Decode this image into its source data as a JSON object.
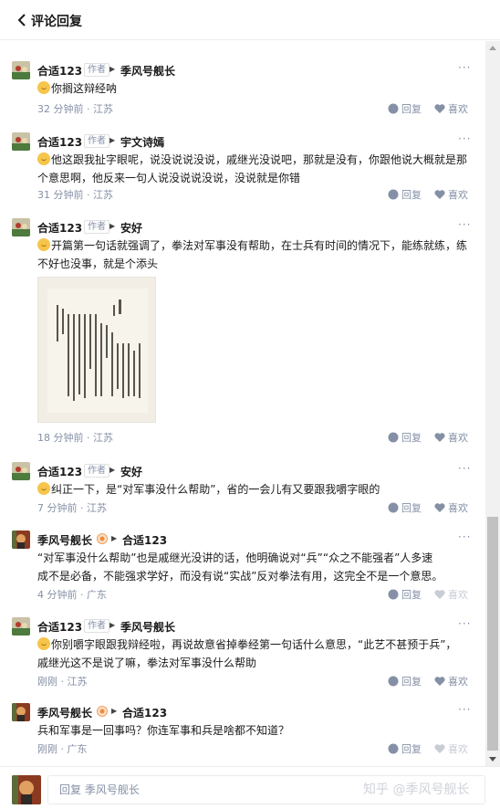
{
  "header": {
    "title": "评论回复"
  },
  "labels": {
    "author_tag": "作者",
    "reply": "回复",
    "like": "喜欢"
  },
  "comments": [
    {
      "author": "合适123",
      "is_author": true,
      "reply_to": "季风号舰长",
      "text": "你搁这辩经呐",
      "emoji": true,
      "time": "32 分钟前",
      "location": "江苏",
      "liked": false
    },
    {
      "author": "合适123",
      "is_author": true,
      "reply_to": "宇文诗嫣",
      "text_lines": [
        "他这跟我扯字眼呢，说没说说没说，戚继光没说吧，那就是没有，你跟他说大概就是那",
        "个意思啊，他反来一句人说没说说没说，没说就是你错"
      ],
      "emoji": true,
      "time": "31 分钟前",
      "location": "江苏",
      "liked": false
    },
    {
      "author": "合适123",
      "is_author": true,
      "reply_to": "安好",
      "text_lines": [
        "开篇第一句话就强调了，拳法对军事没有帮助，在士兵有时间的情况下，能练就练，练",
        "不好也没事，就是个添头"
      ],
      "emoji": true,
      "has_image": true,
      "time": "18 分钟前",
      "location": "江苏",
      "liked": false
    },
    {
      "author": "合适123",
      "is_author": true,
      "reply_to": "安好",
      "text": "纠正一下，是“对军事没什么帮助”，省的一会儿有又要跟我嚼字眼的",
      "emoji": true,
      "time": "7 分钟前",
      "location": "江苏",
      "liked": false
    },
    {
      "author": "季风号舰长",
      "is_author": false,
      "reply_to": "合适123",
      "text_lines": [
        "“对军事没什么帮助”也是戚继光没讲的话，他明确说对“兵”“众之不能强者”人多速",
        "成不是必备，不能强求学好，而没有说“实战”反对拳法有用，这完全不是一个意思。"
      ],
      "emoji": false,
      "time": "4 分钟前",
      "location": "广东",
      "liked": true
    },
    {
      "author": "合适123",
      "is_author": true,
      "reply_to": "季风号舰长",
      "text_lines": [
        "你别嚼字眼跟我辩经啦，再说故意省掉拳经第一句话什么意思，“此艺不甚预于兵”，",
        "戚继光这不是说了嘛，拳法对军事没什么帮助"
      ],
      "emoji": true,
      "time": "刚刚",
      "location": "江苏",
      "liked": false
    },
    {
      "author": "季风号舰长",
      "is_author": false,
      "reply_to": "合适123",
      "text": "兵和军事是一回事吗？你连军事和兵是啥都不知道？",
      "emoji": false,
      "time": "刚刚",
      "location": "广东",
      "liked": true
    }
  ],
  "footer": {
    "placeholder": "回复 季风号舰长",
    "watermark": "知乎 @季风号舰长"
  },
  "colors": {
    "meta": "#8590a6",
    "text": "#1a1a1a",
    "liked": "#c8ccd4"
  }
}
